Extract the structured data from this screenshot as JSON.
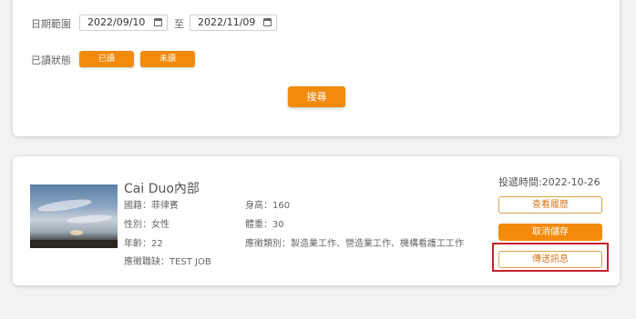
{
  "filter": {
    "date_range_label": "日期範圍",
    "date_from": "2022/09/10",
    "date_sep": "至",
    "date_to": "2022/11/09",
    "read_status_label": "已讀狀態",
    "read_btn": "已讀",
    "unread_btn": "未讀",
    "search_btn": "搜尋"
  },
  "candidate": {
    "name": "Cai Duo內部",
    "nationality": "國籍：菲律賓",
    "gender": "性別：女性",
    "age": "年齡：22",
    "position": "應徵職缺：TEST JOB",
    "height": "身高：160",
    "weight": "體重：30",
    "categories": "應徵類別：製造業工作、營造業工作、機構看護工工作",
    "posted": "投遞時間:2022-10-26",
    "view_resume": "查看履歷",
    "cancel_save": "取消儲存",
    "send_message": "傳送訊息"
  },
  "colors": {
    "accent": "#f28a0c",
    "highlight": "#c8202a"
  }
}
